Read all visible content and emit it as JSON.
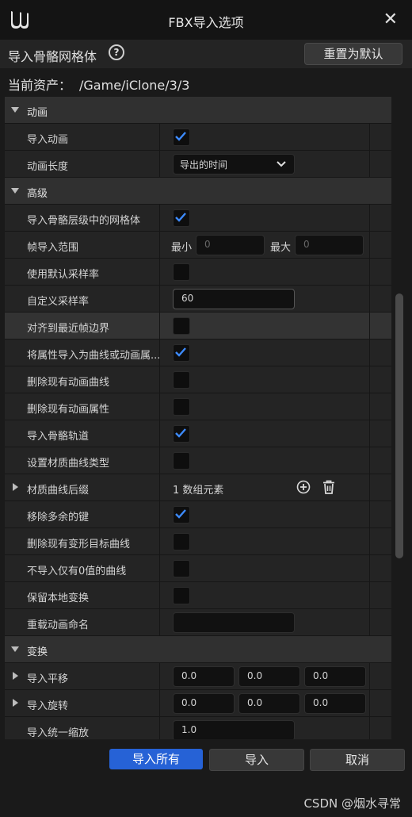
{
  "window": {
    "title": "FBX导入选项",
    "close_icon": "✕"
  },
  "header": {
    "title": "导入骨骼网格体",
    "help_icon": "?",
    "reset_label": "重置为默认"
  },
  "asset": {
    "label": "当前资产：",
    "path": "/Game/iClone/3/3"
  },
  "sections": {
    "animation": {
      "label": "动画"
    },
    "advanced": {
      "label": "高级"
    },
    "transform": {
      "label": "变换"
    }
  },
  "rows": {
    "import_animation": {
      "label": "导入动画",
      "checked": true
    },
    "animation_length": {
      "label": "动画长度",
      "value": "导出的时间"
    },
    "import_meshes_in_bone_hierarchy": {
      "label": "导入骨骼层级中的网格体",
      "checked": true
    },
    "frame_import_range": {
      "label": "帧导入范围",
      "min_label": "最小",
      "min_value": "0",
      "max_label": "最大",
      "max_value": "0"
    },
    "use_default_sample_rate": {
      "label": "使用默认采样率",
      "checked": false
    },
    "custom_sample_rate": {
      "label": "自定义采样率",
      "value": "60"
    },
    "snap_to_closest_frame": {
      "label": "对齐到最近帧边界",
      "checked": false
    },
    "import_attributes_as_curves": {
      "label": "将属性导入为曲线或动画属...",
      "checked": true
    },
    "delete_existing_curves": {
      "label": "删除现有动画曲线",
      "checked": false
    },
    "delete_existing_attributes": {
      "label": "删除现有动画属性",
      "checked": false
    },
    "import_bone_tracks": {
      "label": "导入骨骼轨道",
      "checked": true
    },
    "set_material_curve_type": {
      "label": "设置材质曲线类型",
      "checked": false
    },
    "material_curve_suffixes": {
      "label": "材质曲线后缀",
      "value": "1 数组元素"
    },
    "remove_redundant_keys": {
      "label": "移除多余的键",
      "checked": true
    },
    "delete_morph_target_curves": {
      "label": "删除现有变形目标曲线",
      "checked": false
    },
    "do_not_import_zero_curves": {
      "label": "不导入仅有0值的曲线",
      "checked": false
    },
    "preserve_local_transform": {
      "label": "保留本地变换",
      "checked": false
    },
    "override_animation_name": {
      "label": "重载动画命名",
      "value": ""
    },
    "import_translation": {
      "label": "导入平移",
      "x": "0.0",
      "y": "0.0",
      "z": "0.0"
    },
    "import_rotation": {
      "label": "导入旋转",
      "x": "0.0",
      "y": "0.0",
      "z": "0.0"
    },
    "import_uniform_scale": {
      "label": "导入统一缩放",
      "value": "1.0"
    }
  },
  "footer": {
    "import_all": "导入所有",
    "import": "导入",
    "cancel": "取消"
  },
  "watermark": "CSDN @烟水寻常",
  "colors": {
    "accent": "#2662d6",
    "check": "#3d8bff",
    "background": "#1a1a1a"
  }
}
